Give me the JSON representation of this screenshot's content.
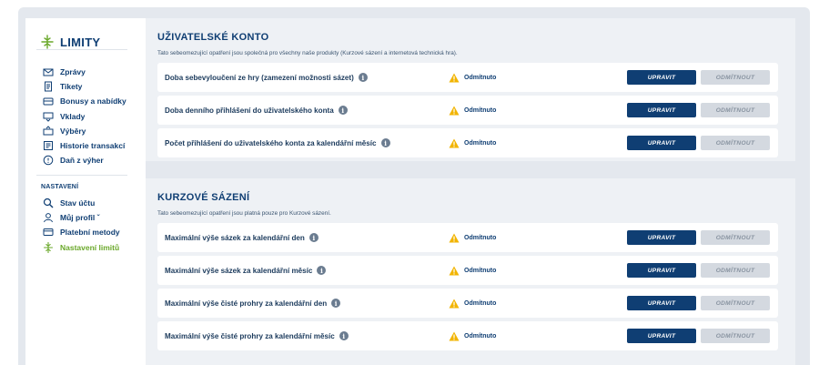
{
  "sidebar": {
    "title": "LIMITY",
    "items": [
      {
        "label": "Zprávy",
        "icon": "envelope-icon"
      },
      {
        "label": "Tikety",
        "icon": "ticket-icon"
      },
      {
        "label": "Bonusy a nabídky",
        "icon": "gift-icon"
      },
      {
        "label": "Vklady",
        "icon": "deposit-icon"
      },
      {
        "label": "Výběry",
        "icon": "withdraw-icon"
      },
      {
        "label": "Historie transakcí",
        "icon": "history-icon"
      },
      {
        "label": "Daň z výher",
        "icon": "tax-icon"
      }
    ],
    "section_label": "NASTAVENÍ",
    "settings_items": [
      {
        "label": "Stav účtu",
        "icon": "search-icon"
      },
      {
        "label": "Můj profil ˇ",
        "icon": "user-icon"
      },
      {
        "label": "Platební metody",
        "icon": "card-icon"
      },
      {
        "label": "Nastavení limitů",
        "icon": "limits-icon",
        "active": true
      }
    ]
  },
  "sections": [
    {
      "title": "UŽIVATELSKÉ KONTO",
      "description": "Tato sebeomezující opatření jsou společná pro všechny naše produkty (Kurzové sázení a internetová technická hra).",
      "rows": [
        {
          "label": "Doba sebevyloučení ze hry (zamezení možnosti sázet)",
          "status": "Odmítnuto",
          "edit": "UPRAVIT",
          "refuse": "ODMÍTNOUT"
        },
        {
          "label": "Doba denního přihlášení do uživatelského konta",
          "status": "Odmítnuto",
          "edit": "UPRAVIT",
          "refuse": "ODMÍTNOUT"
        },
        {
          "label": "Počet přihlášení do uživatelského konta za kalendářní měsíc",
          "status": "Odmítnuto",
          "edit": "UPRAVIT",
          "refuse": "ODMÍTNOUT"
        }
      ]
    },
    {
      "title": "KURZOVÉ SÁZENÍ",
      "description": "Tato sebeomezující opatření jsou platná pouze pro Kurzové sázení.",
      "rows": [
        {
          "label": "Maximální výše sázek za kalendářní den",
          "status": "Odmítnuto",
          "edit": "UPRAVIT",
          "refuse": "ODMÍTNOUT"
        },
        {
          "label": "Maximální výše sázek za kalendářní měsíc",
          "status": "Odmítnuto",
          "edit": "UPRAVIT",
          "refuse": "ODMÍTNOUT"
        },
        {
          "label": "Maximální výše čisté prohry za kalendářní den",
          "status": "Odmítnuto",
          "edit": "UPRAVIT",
          "refuse": "ODMÍTNOUT"
        },
        {
          "label": "Maximální výše čisté prohry za kalendářní měsíc",
          "status": "Odmítnuto",
          "edit": "UPRAVIT",
          "refuse": "ODMÍTNOUT"
        }
      ]
    }
  ],
  "colors": {
    "brand_navy": "#0f3e73",
    "accent_green": "#6aa82a",
    "warning_yellow": "#f2b400",
    "disabled_gray": "#d4d9e0"
  }
}
